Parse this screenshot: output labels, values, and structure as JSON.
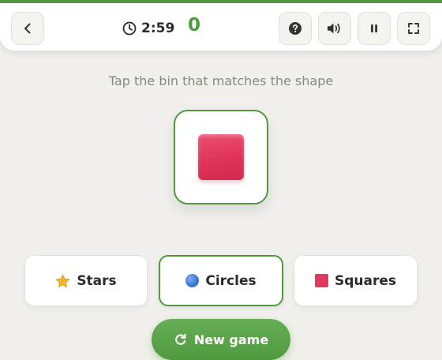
{
  "header": {
    "timer": "2:59",
    "score": "0",
    "icons": {
      "back": "chevron-left-icon",
      "timer": "clock-icon",
      "help": "question-circle-icon",
      "sound": "speaker-icon",
      "pause": "pause-icon",
      "fullscreen": "fullscreen-icon"
    }
  },
  "instruction": "Tap the bin that matches the shape",
  "target": {
    "shape": "square",
    "color": "#df3158"
  },
  "bins": [
    {
      "label": "Stars",
      "icon": "star-icon",
      "color": "#f2b823"
    },
    {
      "label": "Circles",
      "icon": "circle-icon",
      "color": "#3f78d6",
      "selected": true
    },
    {
      "label": "Squares",
      "icon": "square-icon",
      "color": "#e0395e"
    }
  ],
  "new_game": {
    "label": "New game",
    "icon": "restart-icon"
  },
  "colors": {
    "accent": "#4f9a3f",
    "background": "#f1f0ec",
    "text": "#2b2b2b",
    "muted": "#848a83"
  }
}
